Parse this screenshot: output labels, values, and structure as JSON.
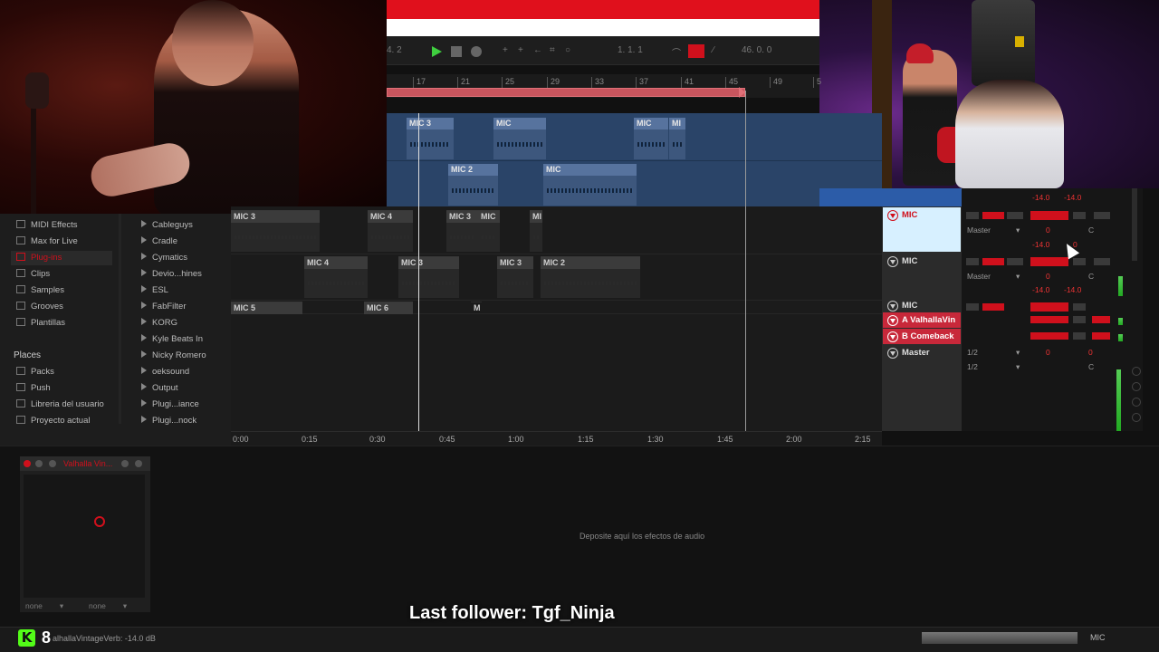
{
  "transport": {
    "position_left": "4.  2",
    "position": "1.  1.  1",
    "position_right": "46.  0.  0"
  },
  "ruler": [
    "17",
    "21",
    "25",
    "29",
    "33",
    "37",
    "41",
    "45",
    "49",
    "5"
  ],
  "clips": {
    "upper1": [
      "MIC 3",
      "MIC",
      "MIC",
      "MI"
    ],
    "upper2": [
      "MIC 2",
      "MIC"
    ],
    "lane1": [
      "MIC 3",
      "MIC 4",
      "MIC 3",
      "MIC",
      "MI"
    ],
    "lane2": [
      "MIC 4",
      "MIC 3",
      "MIC 3",
      "MIC 2"
    ],
    "lane3": [
      "MIC 5",
      "MIC 6",
      "M"
    ]
  },
  "time_ruler": [
    "0:00",
    "0:15",
    "0:30",
    "0:45",
    "1:00",
    "1:15",
    "1:30",
    "1:45",
    "2:00",
    "2:15"
  ],
  "browser": {
    "categories": [
      "MIDI Effects",
      "Max for Live",
      "Plug-ins",
      "Clips",
      "Samples",
      "Grooves",
      "Plantillas"
    ],
    "places_heading": "Places",
    "places": [
      "Packs",
      "Push",
      "Libreria del usuario",
      "Proyecto actual"
    ],
    "plugins": [
      "Cableguys",
      "Cradle",
      "Cymatics",
      "Devio...hines",
      "ESL",
      "FabFilter",
      "KORG",
      "Kyle Beats In",
      "Nicky Romero",
      "oeksound",
      "Output",
      "Plugi...iance",
      "Plugi...nock"
    ]
  },
  "mixer": {
    "tracks": [
      "MIC",
      "MIC",
      "MIC"
    ],
    "returns": [
      "A ValhallaVin",
      "B Comeback"
    ],
    "master": "Master",
    "routing": [
      "Master",
      "Master"
    ],
    "io": [
      "1/2",
      "1/2"
    ],
    "top_values": [
      "-14.0",
      "-14.0"
    ],
    "vals_a": [
      "0",
      "C"
    ],
    "vals_b": [
      "-14.0",
      "0"
    ],
    "vals_c": [
      "0",
      "C"
    ],
    "vals_d": [
      "-14.0",
      "-14.0"
    ],
    "vals_master": [
      "0",
      "0",
      "C"
    ]
  },
  "device": {
    "name": "Valhalla Vin...",
    "dropdowns": [
      "none",
      "none"
    ],
    "drop_hint": "Deposite aquí los efectos de audio"
  },
  "overlay": {
    "follower": "Last follower: Tgf_Ninja",
    "viewer_count": "8"
  },
  "status": {
    "text": "alhallaVintageVerb: -14.0 dB",
    "track": "MIC"
  },
  "colors": {
    "accent": "#d0101c",
    "play": "#3fcf3f",
    "kick": "#53fc18",
    "clip_blue": "#2a4468"
  }
}
